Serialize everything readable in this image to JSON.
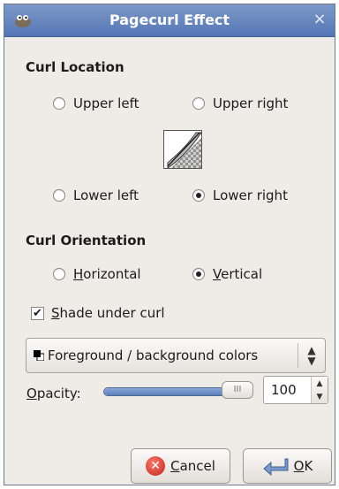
{
  "window": {
    "title": "Pagecurl Effect"
  },
  "curl_location": {
    "title": "Curl Location",
    "options": [
      {
        "label": "Upper left",
        "checked": false
      },
      {
        "label": "Upper right",
        "checked": false
      },
      {
        "label": "Lower left",
        "checked": false
      },
      {
        "label": "Lower right",
        "checked": true
      }
    ]
  },
  "curl_orientation": {
    "title": "Curl Orientation",
    "horizontal": {
      "label": "Horizontal",
      "mnemonic": "H",
      "rest": "orizontal",
      "checked": false
    },
    "vertical": {
      "label": "Vertical",
      "mnemonic": "V",
      "rest": "ertical",
      "checked": true
    }
  },
  "shade": {
    "label": "Shade under curl",
    "mnemonic": "S",
    "rest": "hade under curl",
    "checked": true
  },
  "gradient_select": {
    "value": "Foreground / background colors"
  },
  "opacity": {
    "label": "Opacity:",
    "mnemonic": "O",
    "rest": "pacity:",
    "value": "100",
    "fraction": 1.0
  },
  "buttons": {
    "cancel": {
      "label": "Cancel",
      "mnemonic": "C",
      "rest": "ancel"
    },
    "ok": {
      "label": "OK",
      "mnemonic": "O",
      "rest": "K"
    }
  },
  "colors": {
    "titlebar": "#5577b5",
    "dialog_bg": "#efebe7",
    "slider_fill": "#5b7fbd"
  },
  "icons": {
    "app": "gimp-wilber-icon",
    "close": "close-icon",
    "cancel": "cancel-icon",
    "ok": "ok-arrow-icon"
  }
}
